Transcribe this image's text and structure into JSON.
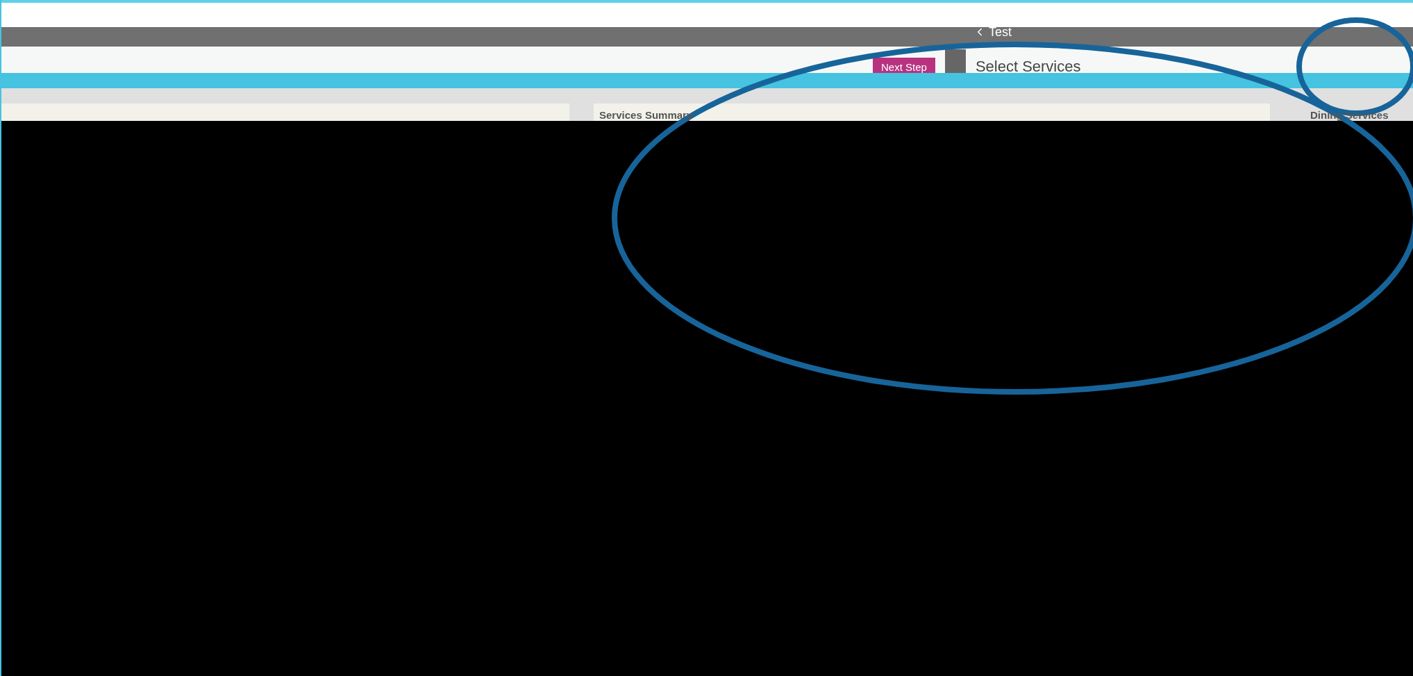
{
  "header": {
    "back_link": "Test"
  },
  "toolbar": {
    "next_button": "Next Step",
    "step_title": "Select Services"
  },
  "panels": [
    {
      "title": "Services Summary"
    },
    {
      "title": "Dining Services"
    }
  ],
  "annotations": [
    {
      "kind": "ellipse"
    },
    {
      "kind": "ellipse"
    }
  ]
}
